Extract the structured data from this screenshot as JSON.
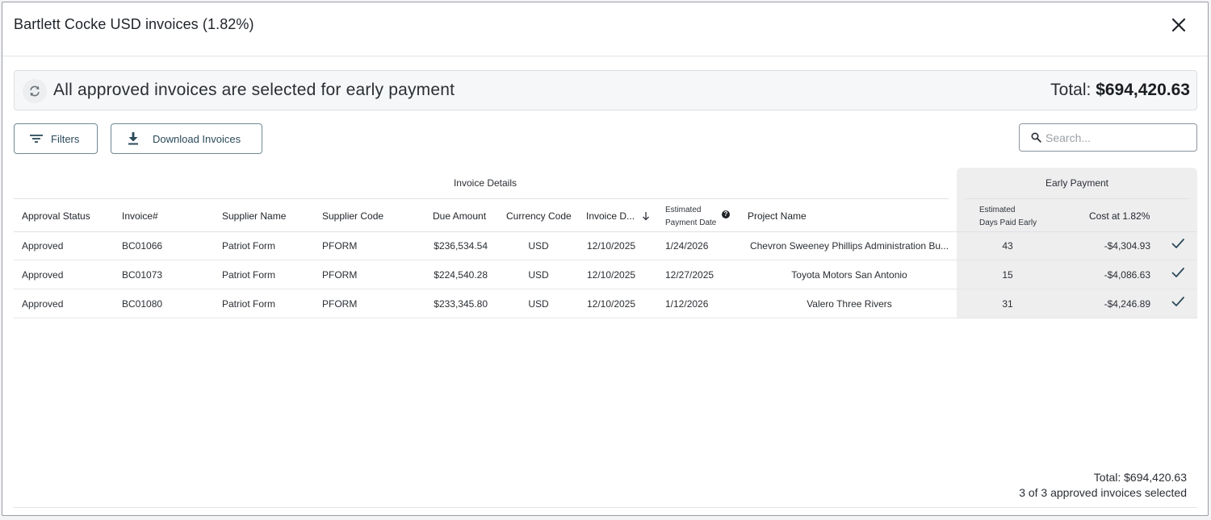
{
  "modal": {
    "title": "Bartlett Cocke USD invoices (1.82%)"
  },
  "banner": {
    "message": "All approved invoices are selected for early payment",
    "total_label": "Total: ",
    "total_value": "$694,420.63"
  },
  "toolbar": {
    "filters_label": "Filters",
    "download_label": "Download Invoices",
    "search_placeholder": "Search..."
  },
  "table": {
    "group_invoice_details": "Invoice Details",
    "group_early_payment": "Early Payment",
    "headers": {
      "approval_status": "Approval Status",
      "invoice_no": "Invoice#",
      "supplier_name": "Supplier Name",
      "supplier_code": "Supplier Code",
      "due_amount": "Due Amount",
      "currency_code": "Currency Code",
      "invoice_date": "Invoice D...",
      "est_payment_line1": "Estimated",
      "est_payment_line2": "Payment Date",
      "project_name": "Project Name",
      "days_early_line1": "Estimated",
      "days_early_line2": "Days Paid Early",
      "cost": "Cost at 1.82%"
    },
    "rows": [
      {
        "approval_status": "Approved",
        "invoice_no": "BC01066",
        "supplier_name": "Patriot Form",
        "supplier_code": "PFORM",
        "due_amount": "$236,534.54",
        "currency_code": "USD",
        "invoice_date": "12/10/2025",
        "est_payment_date": "1/24/2026",
        "project_name": "Chevron Sweeney Phillips Administration Bu...",
        "days_early": "43",
        "cost": "-$4,304.93"
      },
      {
        "approval_status": "Approved",
        "invoice_no": "BC01073",
        "supplier_name": "Patriot Form",
        "supplier_code": "PFORM",
        "due_amount": "$224,540.28",
        "currency_code": "USD",
        "invoice_date": "12/10/2025",
        "est_payment_date": "12/27/2025",
        "project_name": "Toyota Motors San Antonio",
        "days_early": "15",
        "cost": "-$4,086.63"
      },
      {
        "approval_status": "Approved",
        "invoice_no": "BC01080",
        "supplier_name": "Patriot Form",
        "supplier_code": "PFORM",
        "due_amount": "$233,345.80",
        "currency_code": "USD",
        "invoice_date": "12/10/2025",
        "est_payment_date": "1/12/2026",
        "project_name": "Valero Three Rivers",
        "days_early": "31",
        "cost": "-$4,246.89"
      }
    ]
  },
  "footer": {
    "total": "Total: $694,420.63",
    "count": "3 of 3 approved invoices selected"
  },
  "colors": {
    "accent": "#2b4a5a",
    "early_payment_bg": "#eeeeef",
    "border": "#dfe1e4"
  }
}
